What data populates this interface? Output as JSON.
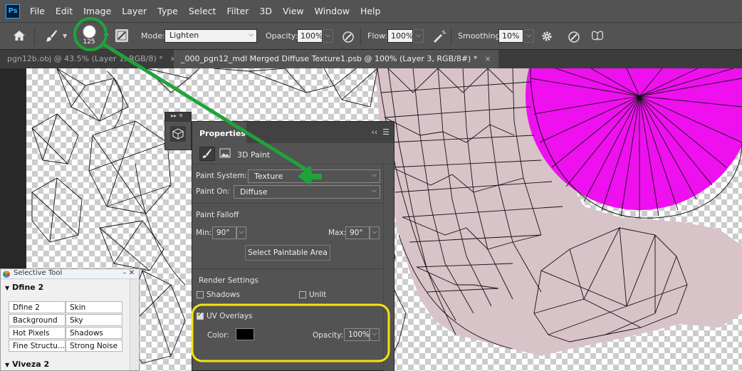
{
  "menu": {
    "logo": "Ps",
    "items": [
      "File",
      "Edit",
      "Image",
      "Layer",
      "Type",
      "Select",
      "Filter",
      "3D",
      "View",
      "Window",
      "Help"
    ]
  },
  "options": {
    "brush_size": "125",
    "mode_label": "Mode:",
    "mode_value": "Lighten",
    "opacity_label": "Opacity:",
    "opacity_value": "100%",
    "flow_label": "Flow:",
    "flow_value": "100%",
    "smoothing_label": "Smoothing:",
    "smoothing_value": "10%"
  },
  "tabs": [
    {
      "label": "pgn12b.obj @ 43.5% (Layer 1, RGB/8) *",
      "close": "×"
    },
    {
      "label": "_000_pgn12_mdl Merged Diffuse Texture1.psb @ 100% (Layer 3, RGB/8#) *",
      "close": "×"
    }
  ],
  "properties": {
    "panel_title": "Properties",
    "sub_label": "3D Paint",
    "paint_system_label": "Paint System:",
    "paint_system_value": "Texture",
    "paint_on_label": "Paint On:",
    "paint_on_value": "Diffuse",
    "falloff_heading": "Paint Falloff",
    "min_label": "Min:",
    "min_value": "90°",
    "max_label": "Max:",
    "max_value": "90°",
    "select_area_button": "Select Paintable Area",
    "render_heading": "Render Settings",
    "shadows_label": "Shadows",
    "unlit_label": "Unlit",
    "uv_overlays_label": "UV Overlays",
    "color_label": "Color:",
    "opacity_label": "Opacity:",
    "opacity_value": "100%",
    "overlay_color": "#000000"
  },
  "selective_tool": {
    "title": "Selective Tool",
    "section1": "Dfine 2",
    "cells": [
      [
        "Dfine 2",
        "Skin"
      ],
      [
        "Background",
        "Sky"
      ],
      [
        "Hot Pixels",
        "Shadows"
      ],
      [
        "Fine Structu...",
        "Strong Noise"
      ]
    ],
    "section2": "Viveza 2"
  },
  "colors": {
    "annotation_green": "#1fa33a",
    "annotation_yellow": "#f5e50a",
    "magenta": "#ee10ee",
    "skin": "#d8c3c8"
  }
}
